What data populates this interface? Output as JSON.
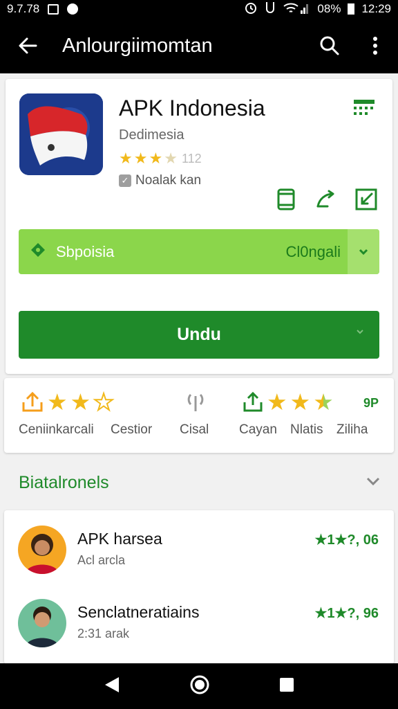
{
  "status_bar": {
    "left_text": "9.7.78",
    "battery": "08%",
    "time": "12:29"
  },
  "app_bar": {
    "title": "Anlourgiimomtan"
  },
  "app": {
    "name": "APK Indonesia",
    "developer": "Dedimesia",
    "rating_stars": 3.5,
    "rating_count": "112",
    "badge": "Noalak kan"
  },
  "promo": {
    "label": "Sbpoisia",
    "right_text": "Cl0ngali"
  },
  "download": {
    "label": "Undu"
  },
  "stats": {
    "labels": [
      "Ceniinkarcali",
      "Cestior",
      "Cisal",
      "Cayan",
      "Nlatis",
      "Ziliha"
    ],
    "right_number": "9P"
  },
  "section": {
    "title": "Biatalronels"
  },
  "reviews": [
    {
      "name": "APK harsea",
      "sub": "Acl arcla",
      "rating": "★1★?, 06"
    },
    {
      "name": "Senclatneratiains",
      "sub": "2:31 arak",
      "rating": "★1★?, 96"
    }
  ],
  "colors": {
    "accent_green": "#1f8a2a",
    "promo_green": "#8bd64b",
    "star_yellow": "#f1b91b",
    "icon_orange": "#f59e1b"
  },
  "icons": [
    "back-arrow-icon",
    "search-icon",
    "more-vert-icon",
    "grid-icon",
    "phone-icon",
    "share-icon",
    "resize-icon",
    "tag-icon",
    "chevron-down-icon",
    "upload-icon",
    "star-icon",
    "broadcast-icon",
    "nav-back-icon",
    "nav-home-icon",
    "nav-recent-icon"
  ]
}
